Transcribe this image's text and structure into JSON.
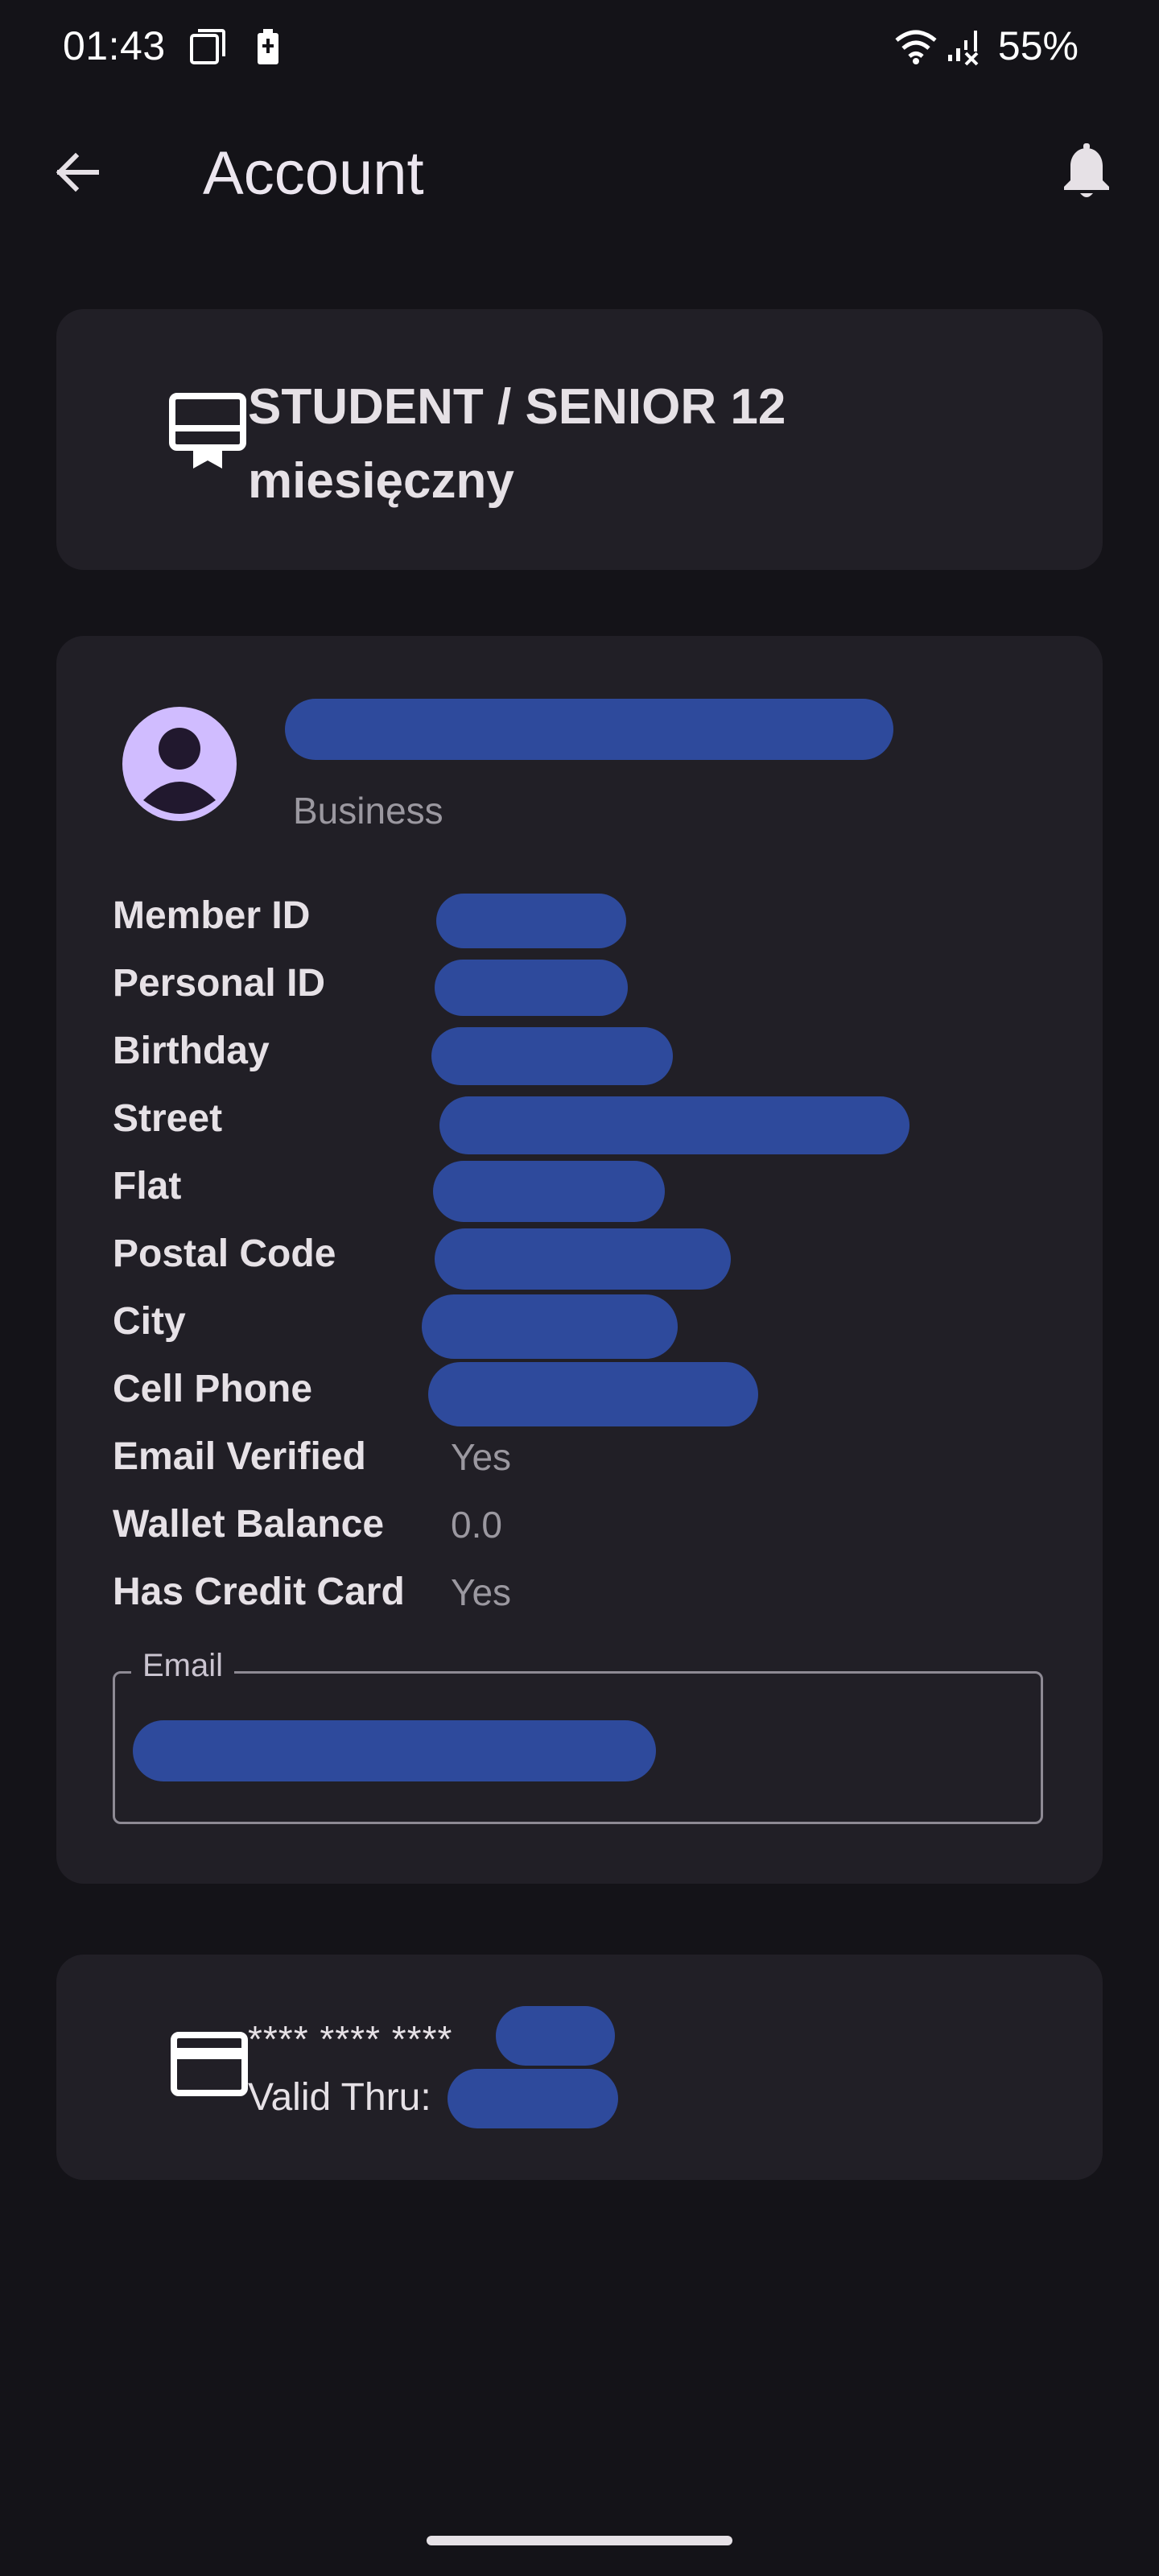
{
  "status_bar": {
    "time": "01:43",
    "battery_percent": "55%",
    "icons": [
      "screenshot-icon",
      "battery-saver-icon",
      "wifi-icon",
      "no-signal-icon"
    ]
  },
  "app_bar": {
    "title": "Account",
    "back_icon": "arrow-back-icon",
    "notifications_icon": "bell-icon"
  },
  "plan": {
    "icon": "ticket-card-icon",
    "name": "STUDENT / SENIOR 12 miesięczny"
  },
  "profile": {
    "avatar_icon": "account-circle-icon",
    "account_type": "Business",
    "rows": [
      {
        "label": "Member ID",
        "value": ""
      },
      {
        "label": "Personal ID",
        "value": ""
      },
      {
        "label": "Birthday",
        "value": ""
      },
      {
        "label": "Street",
        "value": ""
      },
      {
        "label": "Flat",
        "value": ""
      },
      {
        "label": "Postal Code",
        "value": ""
      },
      {
        "label": "City",
        "value": ""
      },
      {
        "label": "Cell Phone",
        "value": ""
      },
      {
        "label": "Email Verified",
        "value": "Yes"
      },
      {
        "label": "Wallet Balance",
        "value": "0.0"
      },
      {
        "label": "Has Credit Card",
        "value": "Yes"
      }
    ],
    "email_label": "Email"
  },
  "payment": {
    "icon": "credit-card-icon",
    "masked_number": "**** **** ****",
    "valid_thru_label": "Valid Thru:"
  },
  "colors": {
    "background": "#141318",
    "card": "#211f26",
    "avatar": "#d0bcff",
    "redaction": "#2e4a9c",
    "text_primary": "#e6e1e6",
    "text_secondary": "#9b98a0"
  }
}
